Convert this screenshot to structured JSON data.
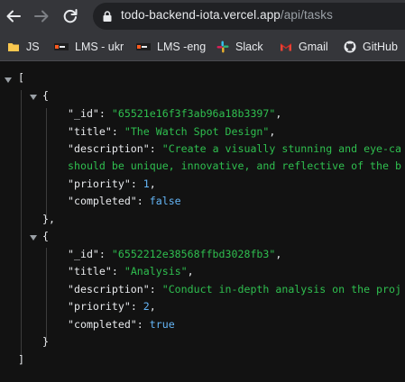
{
  "browser": {
    "url_host": "todo-backend-iota.vercel.app",
    "url_path": "/api/tasks"
  },
  "bookmarks": [
    {
      "label": "JS",
      "icon": "folder-icon"
    },
    {
      "label": "LMS - ukr",
      "icon": "lms-icon"
    },
    {
      "label": "LMS -eng",
      "icon": "lms-icon"
    },
    {
      "label": "Slack",
      "icon": "slack-icon"
    },
    {
      "label": "Gmail",
      "icon": "gmail-icon"
    },
    {
      "label": "GitHub",
      "icon": "github-icon"
    }
  ],
  "json_view": {
    "open_bracket": "[",
    "close_bracket": "]",
    "tasks": [
      {
        "_id": "65521e16f3f3ab96a18b3397",
        "title": "The Watch Spot Design",
        "description_line1": "Create a visually stunning and eye-ca",
        "description_line2": "should be unique, innovative, and reflective of the b",
        "priority": "1",
        "completed": "false",
        "closing": "},"
      },
      {
        "_id": "6552212e38568ffbd3028fb3",
        "title": "Analysis",
        "description_line1": "Conduct in-depth analysis on the proj",
        "priority": "2",
        "completed": "true",
        "closing": "}"
      }
    ],
    "keys": {
      "id": "\"_id\"",
      "title": "\"title\"",
      "description": "\"description\"",
      "priority": "\"priority\"",
      "completed": "\"completed\""
    }
  }
}
